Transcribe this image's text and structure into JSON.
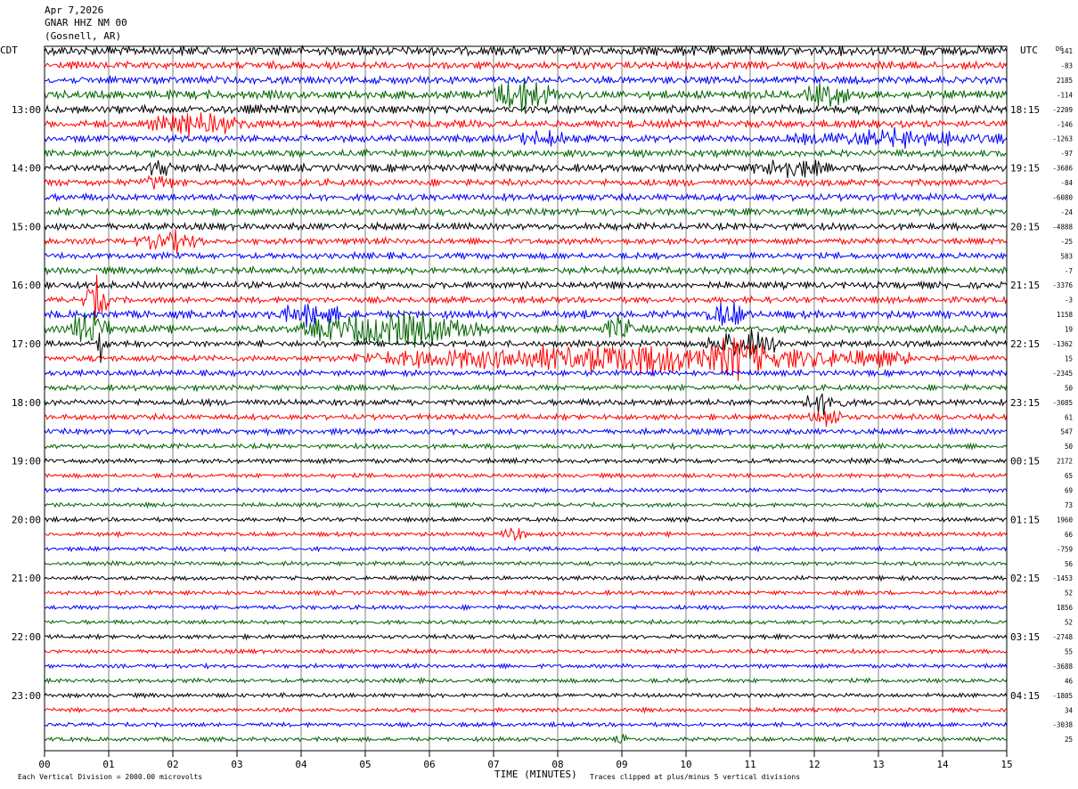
{
  "header": {
    "date": "Apr 7,2026",
    "station": "GNAR HHZ NM 00",
    "location": "(Gosnell, AR)"
  },
  "labels": {
    "left_tz": "CDT",
    "right_tz": "UTC",
    "dc": "DC",
    "xlabel": "TIME (MINUTES)",
    "scale_note": "Each Vertical Division = 2000.00 microvolts",
    "clip_note": "Traces clipped at plus/minus 5 vertical divisions"
  },
  "colors": [
    "#000000",
    "#ff0000",
    "#0000ff",
    "#006400"
  ],
  "chart_data": {
    "type": "line",
    "title": "GNAR HHZ NM 00",
    "xlabel": "TIME (MINUTES)",
    "xlim": [
      0,
      15
    ],
    "x_ticks": [
      "00",
      "01",
      "02",
      "03",
      "04",
      "05",
      "06",
      "07",
      "08",
      "09",
      "10",
      "11",
      "12",
      "13",
      "14",
      "15"
    ],
    "left_hour_labels": [
      "13:00",
      "14:00",
      "15:00",
      "16:00",
      "17:00",
      "18:00",
      "19:00",
      "20:00",
      "21:00",
      "22:00",
      "23:00"
    ],
    "right_hour_labels": [
      "18:15",
      "19:15",
      "20:15",
      "21:15",
      "22:15",
      "23:15",
      "00:15",
      "01:15",
      "02:15",
      "03:15",
      "04:15"
    ],
    "first_hour_label_row": 4,
    "dc_offsets": [
      "141",
      "-83",
      "2185",
      "-114",
      "-2209",
      "-146",
      "-1263",
      "-97",
      "-3686",
      "-84",
      "-6080",
      "-24",
      "-4888",
      "-25",
      "583",
      "-7",
      "-3376",
      "-3",
      "1158",
      "19",
      "-1362",
      "15",
      "-2345",
      "50",
      "-3085",
      "61",
      "547",
      "50",
      "2172",
      "65",
      "69",
      "73",
      "1960",
      "66",
      "-759",
      "56",
      "-1453",
      "52",
      "1856",
      "52",
      "-2748",
      "55",
      "-3688",
      "46",
      "-1805",
      "34",
      "-3038",
      "25"
    ],
    "row_amplitude": [
      1.4,
      1.1,
      1.1,
      1.2,
      1.2,
      1.1,
      1.0,
      1.0,
      1.1,
      1.0,
      1.0,
      1.0,
      1.0,
      0.9,
      0.9,
      1.0,
      1.0,
      0.9,
      1.1,
      1.1,
      0.9,
      0.9,
      0.8,
      0.8,
      0.9,
      0.8,
      0.8,
      0.7,
      0.7,
      0.6,
      0.6,
      0.6,
      0.6,
      0.6,
      0.6,
      0.6,
      0.6,
      0.6,
      0.6,
      0.6,
      0.6,
      0.6,
      0.6,
      0.6,
      0.6,
      0.6,
      0.6,
      0.6
    ],
    "events": [
      {
        "row": 3,
        "start": 6.9,
        "end": 8.0,
        "amp": 2.2
      },
      {
        "row": 3,
        "start": 11.8,
        "end": 12.6,
        "amp": 1.6
      },
      {
        "row": 5,
        "start": 1.5,
        "end": 3.3,
        "amp": 1.6
      },
      {
        "row": 6,
        "start": 7.2,
        "end": 8.4,
        "amp": 1.3
      },
      {
        "row": 6,
        "start": 11.5,
        "end": 15.0,
        "amp": 1.4
      },
      {
        "row": 8,
        "start": 1.6,
        "end": 2.0,
        "amp": 1.8
      },
      {
        "row": 8,
        "start": 11.0,
        "end": 12.2,
        "amp": 1.6
      },
      {
        "row": 9,
        "start": 1.5,
        "end": 2.0,
        "amp": 1.6
      },
      {
        "row": 13,
        "start": 1.4,
        "end": 2.5,
        "amp": 1.8
      },
      {
        "row": 17,
        "start": 0.6,
        "end": 1.0,
        "amp": 3.5
      },
      {
        "row": 18,
        "start": 3.5,
        "end": 4.8,
        "amp": 1.5
      },
      {
        "row": 18,
        "start": 10.3,
        "end": 11.0,
        "amp": 1.8
      },
      {
        "row": 19,
        "start": 0.4,
        "end": 1.0,
        "amp": 3.0
      },
      {
        "row": 19,
        "start": 4.0,
        "end": 6.8,
        "amp": 2.5
      },
      {
        "row": 19,
        "start": 8.7,
        "end": 9.2,
        "amp": 2.0
      },
      {
        "row": 20,
        "start": 0.8,
        "end": 1.0,
        "amp": 3.5
      },
      {
        "row": 20,
        "start": 10.3,
        "end": 11.5,
        "amp": 2.5
      },
      {
        "row": 21,
        "start": 4.8,
        "end": 13.5,
        "amp": 2.5
      },
      {
        "row": 21,
        "start": 10.3,
        "end": 11.3,
        "amp": 4.0
      },
      {
        "row": 24,
        "start": 11.8,
        "end": 12.5,
        "amp": 2.0
      },
      {
        "row": 25,
        "start": 11.9,
        "end": 12.5,
        "amp": 2.0
      },
      {
        "row": 33,
        "start": 7.1,
        "end": 7.5,
        "amp": 2.0
      },
      {
        "row": 47,
        "start": 8.9,
        "end": 9.1,
        "amp": 1.6
      }
    ]
  }
}
